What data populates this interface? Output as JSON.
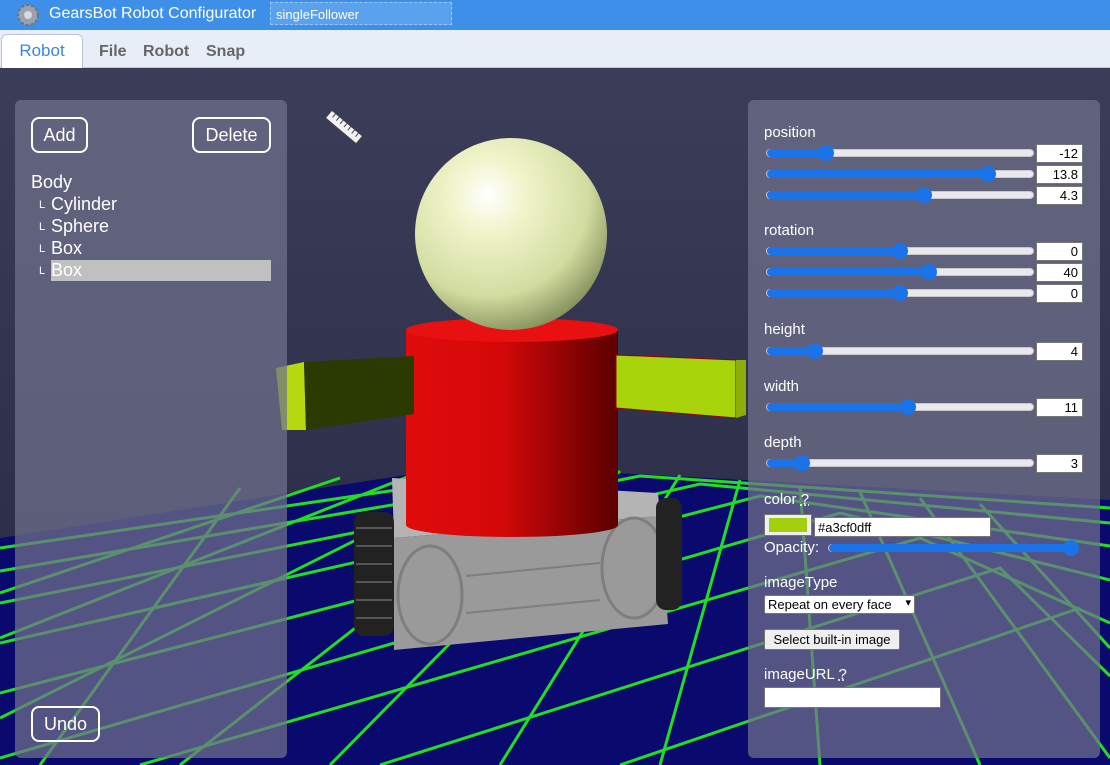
{
  "header": {
    "app_title": "GearsBot Robot Configurator",
    "filename": "singleFollower",
    "logo_icon": "gear-icon"
  },
  "menu": {
    "active_tab": "Robot",
    "items": [
      "File",
      "Robot",
      "Snap"
    ]
  },
  "left_panel": {
    "add_label": "Add",
    "delete_label": "Delete",
    "undo_label": "Undo",
    "tree": {
      "root": "Body",
      "items": [
        {
          "prefix": "L",
          "label": "Cylinder",
          "selected": false
        },
        {
          "prefix": "L",
          "label": "Sphere",
          "selected": false
        },
        {
          "prefix": "L",
          "label": "Box",
          "selected": false
        },
        {
          "prefix": "L",
          "label": "Box",
          "selected": true
        }
      ]
    }
  },
  "viewport": {
    "ruler_icon": "ruler-icon"
  },
  "properties": {
    "position": {
      "label": "position",
      "values": [
        "-12",
        "13.8",
        "4.3"
      ],
      "slider_fraction": [
        0.22,
        0.83,
        0.59
      ]
    },
    "rotation": {
      "label": "rotation",
      "values": [
        "0",
        "40",
        "0"
      ],
      "slider_fraction": [
        0.5,
        0.61,
        0.5
      ]
    },
    "height": {
      "label": "height",
      "value": "4",
      "slider_fraction": 0.18
    },
    "width": {
      "label": "width",
      "value": "11",
      "slider_fraction": 0.53
    },
    "depth": {
      "label": "depth",
      "value": "3",
      "slider_fraction": 0.13
    },
    "color": {
      "label": "color",
      "help": "?",
      "hex": "#a3cf0dff",
      "swatch": "#a3cf0d"
    },
    "opacity": {
      "label": "Opacity:",
      "slider_fraction": 1.0
    },
    "image_type": {
      "label": "imageType",
      "selected": "Repeat on every face"
    },
    "builtin_button": "Select built-in image",
    "image_url": {
      "label": "imageURL",
      "help": "?",
      "value": ""
    }
  },
  "colors": {
    "titlebar": "#3d8fe8",
    "accent": "#1a73e8",
    "grid": "#22dd22",
    "floor": "#0a0a6e"
  }
}
